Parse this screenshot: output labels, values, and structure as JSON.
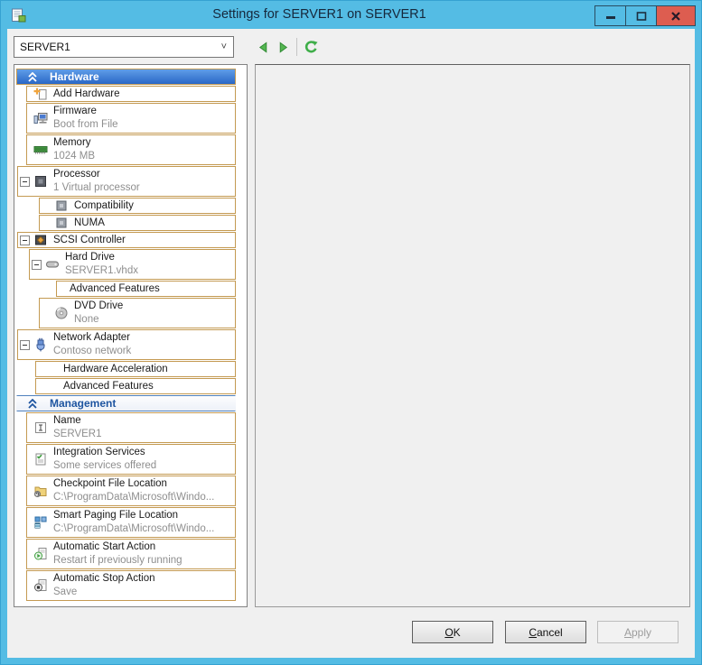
{
  "window": {
    "title": "Settings for SERVER1 on SERVER1",
    "controls": {
      "minimize": "minimize",
      "maximize": "maximize",
      "close": "close"
    }
  },
  "toolbar": {
    "server_selector": "SERVER1",
    "back": "back",
    "forward": "forward",
    "refresh": "refresh"
  },
  "sidebar": {
    "sections": [
      {
        "label": "Hardware",
        "items": [
          {
            "label": "Add Hardware"
          },
          {
            "label": "Firmware",
            "sublabel": "Boot from File"
          },
          {
            "label": "Memory",
            "sublabel": "1024 MB"
          },
          {
            "label": "Processor",
            "sublabel": "1 Virtual processor"
          },
          {
            "label": "Compatibility"
          },
          {
            "label": "NUMA"
          },
          {
            "label": "SCSI Controller"
          },
          {
            "label": "Hard Drive",
            "sublabel": "SERVER1.vhdx"
          },
          {
            "label": "Advanced Features"
          },
          {
            "label": "DVD Drive",
            "sublabel": "None"
          },
          {
            "label": "Network Adapter",
            "sublabel": "Contoso network"
          },
          {
            "label": "Hardware Acceleration"
          },
          {
            "label": "Advanced Features"
          }
        ]
      },
      {
        "label": "Management",
        "items": [
          {
            "label": "Name",
            "sublabel": "SERVER1"
          },
          {
            "label": "Integration Services",
            "sublabel": "Some services offered"
          },
          {
            "label": "Checkpoint File Location",
            "sublabel": "C:\\ProgramData\\Microsoft\\Windo..."
          },
          {
            "label": "Smart Paging File Location",
            "sublabel": "C:\\ProgramData\\Microsoft\\Windo..."
          },
          {
            "label": "Automatic Start Action",
            "sublabel": "Restart if previously running"
          },
          {
            "label": "Automatic Stop Action",
            "sublabel": "Save"
          }
        ]
      }
    ]
  },
  "footer": {
    "ok": "OK",
    "cancel": "Cancel",
    "apply": "Apply"
  },
  "colors": {
    "frame_blue": "#54bce4",
    "close_red": "#dd5d50",
    "hardware_header_top": "#5f9de8",
    "hardware_header_bottom": "#2a67c6",
    "management_text_blue": "#1e55a0",
    "item_outline_orange": "#c49a52",
    "dialog_background": "#f0f0f0",
    "nav_green": "#3fae49"
  }
}
